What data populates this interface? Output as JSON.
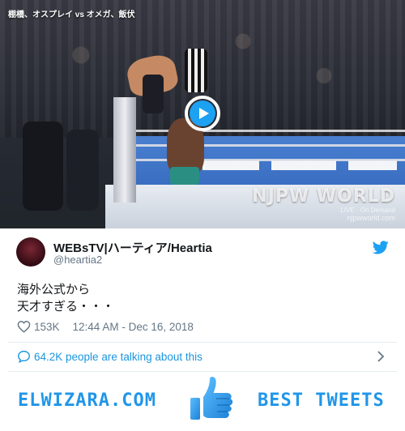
{
  "media": {
    "caption": "棚橋、オスプレイ vs オメガ、飯伏",
    "watermark_logo": "NJPW WORLD",
    "watermark_sub": "LIVE · On Demand",
    "watermark_url": "njpwworld.com"
  },
  "tweet": {
    "display_name": "WEBsTV|ハーティア/Heartia",
    "screen_name": "@heartia2",
    "text_lines": [
      "海外公式から",
      "天才すぎる・・・"
    ],
    "likes": "153K",
    "timestamp": "12:44 AM - Dec 16, 2018",
    "talking": "64.2K people are talking about this"
  },
  "footer": {
    "site_name": "ELWIZARA.COM",
    "section": "BEST TWEETS"
  },
  "colors": {
    "twitter_blue": "#1da1f2",
    "link_blue": "#1b95e0",
    "footer_blue": "#2196e8",
    "meta_gray": "#657786"
  },
  "icons": {
    "play": "play-icon",
    "bird": "twitter-bird-icon",
    "heart": "heart-icon",
    "comment": "comment-icon",
    "chevron": "chevron-right-icon",
    "thumbs_up": "thumbs-up-icon"
  }
}
